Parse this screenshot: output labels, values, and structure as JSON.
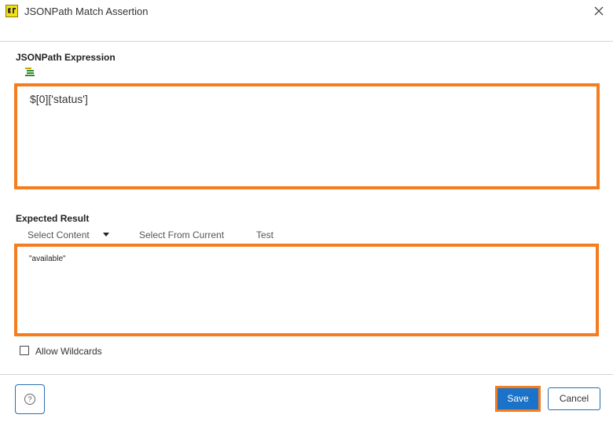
{
  "window": {
    "title": "JSONPath Match Assertion",
    "close_icon": "close-icon",
    "app_icon": "soapui-app-icon"
  },
  "expression": {
    "label": "JSONPath Expression",
    "value": "$[0]['status']",
    "format_icon": "format-tree-icon",
    "highlight_color": "#f57c1f"
  },
  "expected": {
    "label": "Expected Result",
    "toolbar": {
      "select_content": "Select Content",
      "select_from_current": "Select From Current",
      "test": "Test"
    },
    "value": "\"available\""
  },
  "options": {
    "allow_wildcards_label": "Allow Wildcards",
    "allow_wildcards_checked": false
  },
  "footer": {
    "help_icon": "help-icon",
    "save_label": "Save",
    "cancel_label": "Cancel",
    "primary_color": "#1a73c8"
  }
}
